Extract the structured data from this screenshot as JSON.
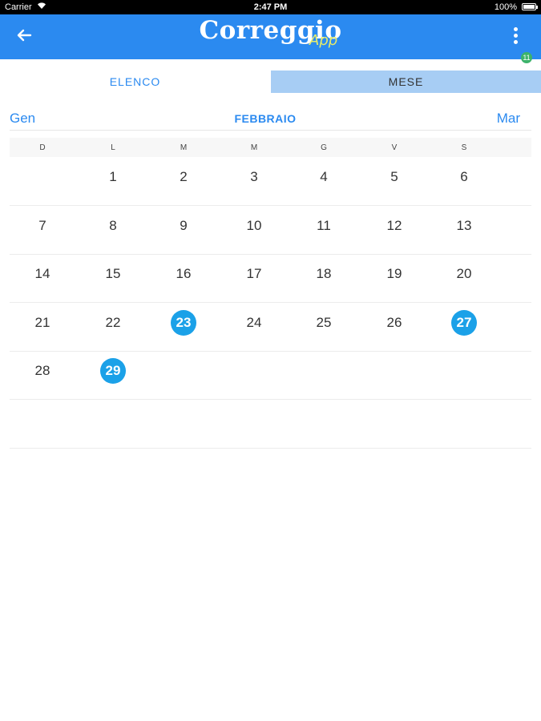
{
  "status_bar": {
    "carrier": "Carrier",
    "time": "2:47 PM",
    "battery": "100%"
  },
  "app_bar": {
    "title_main": "Correggio",
    "title_sub": "App",
    "notification_count": "11",
    "back_icon": "arrow-left-icon",
    "menu_icon": "vertical-dots-icon"
  },
  "tabs": {
    "elenco": "ELENCO",
    "mese": "MESE",
    "selected": "MESE"
  },
  "month_nav": {
    "prev": "Gen",
    "current": "FEBBRAIO",
    "next": "Mar"
  },
  "weekdays": [
    "D",
    "L",
    "M",
    "M",
    "G",
    "V",
    "S"
  ],
  "weeks": [
    [
      "",
      "1",
      "2",
      "3",
      "4",
      "5",
      "6"
    ],
    [
      "7",
      "8",
      "9",
      "10",
      "11",
      "12",
      "13"
    ],
    [
      "14",
      "15",
      "16",
      "17",
      "18",
      "19",
      "20"
    ],
    [
      "21",
      "22",
      "23",
      "24",
      "25",
      "26",
      "27"
    ],
    [
      "28",
      "29",
      "",
      "",
      "",
      "",
      ""
    ],
    [
      "",
      "",
      "",
      "",
      "",
      "",
      ""
    ]
  ],
  "highlighted_days": [
    "23",
    "27",
    "29"
  ],
  "colors": {
    "primary": "#2b8af0",
    "tab_selected_bg": "#a7cdf4",
    "highlight": "#1ba1e8",
    "badge": "#3db36b",
    "logo_sub": "#e7ec6a"
  }
}
